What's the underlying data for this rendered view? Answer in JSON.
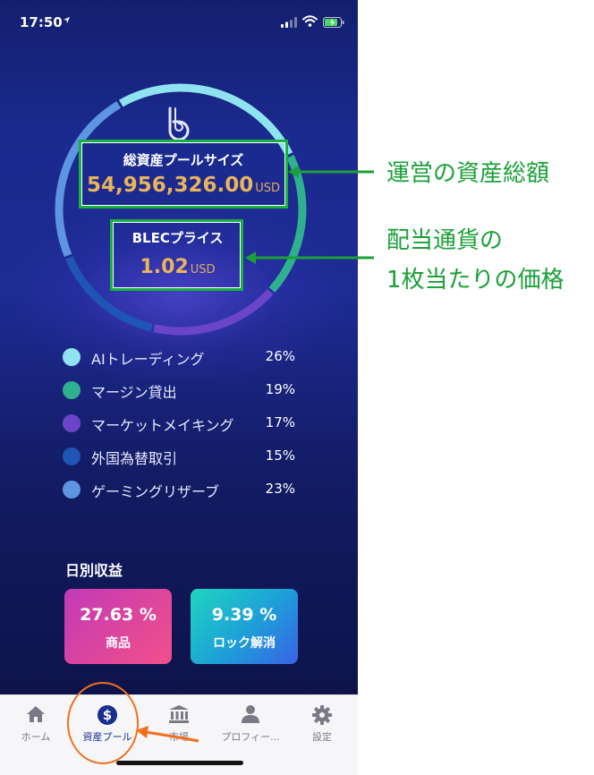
{
  "status_bar": {
    "time": "17:50",
    "location_icon": "location-arrow-icon",
    "signal_icon": "signal-bars-icon",
    "wifi_icon": "wifi-icon",
    "battery_icon": "battery-charging-icon"
  },
  "pool": {
    "logo_icon": "b-logo-icon",
    "total_label": "総資産プールサイズ",
    "total_value": "54,956,326.00",
    "total_unit": "USD",
    "blec_label": "BLECプライス",
    "blec_value": "1.02",
    "blec_unit": "USD"
  },
  "allocation": [
    {
      "name": "AIトレーディング",
      "percent": "26%",
      "value": 26,
      "color": "#8fe3f0"
    },
    {
      "name": "マージン貸出",
      "percent": "19%",
      "value": 19,
      "color": "#2fb08e"
    },
    {
      "name": "マーケットメイキング",
      "percent": "17%",
      "value": 17,
      "color": "#6b45c8"
    },
    {
      "name": "外国為替取引",
      "percent": "15%",
      "value": 15,
      "color": "#1f55b4"
    },
    {
      "name": "ゲーミングリザーブ",
      "percent": "23%",
      "value": 23,
      "color": "#5d95e2"
    }
  ],
  "daily": {
    "title": "日別収益",
    "cards": [
      {
        "value": "27.63 %",
        "label": "商品"
      },
      {
        "value": "9.39 %",
        "label": "ロック解消"
      }
    ]
  },
  "tabs": [
    {
      "label": "ホーム",
      "icon": "home-icon",
      "active": false
    },
    {
      "label": "資産プール",
      "icon": "dollar-coin-icon",
      "active": true
    },
    {
      "label": "市場",
      "icon": "bank-icon",
      "active": false
    },
    {
      "label": "プロフィー...",
      "icon": "person-icon",
      "active": false
    },
    {
      "label": "設定",
      "icon": "gear-icon",
      "active": false
    }
  ],
  "annotations": {
    "total_note": "運営の資産総額",
    "price_note_line1": "配当通貨の",
    "price_note_line2": "1枚当たりの価格"
  },
  "colors": {
    "gold": "#e8b45c",
    "annotation_green": "#1aa038",
    "annotation_orange": "#f26f1d",
    "active_tab": "#1a2e8f"
  }
}
